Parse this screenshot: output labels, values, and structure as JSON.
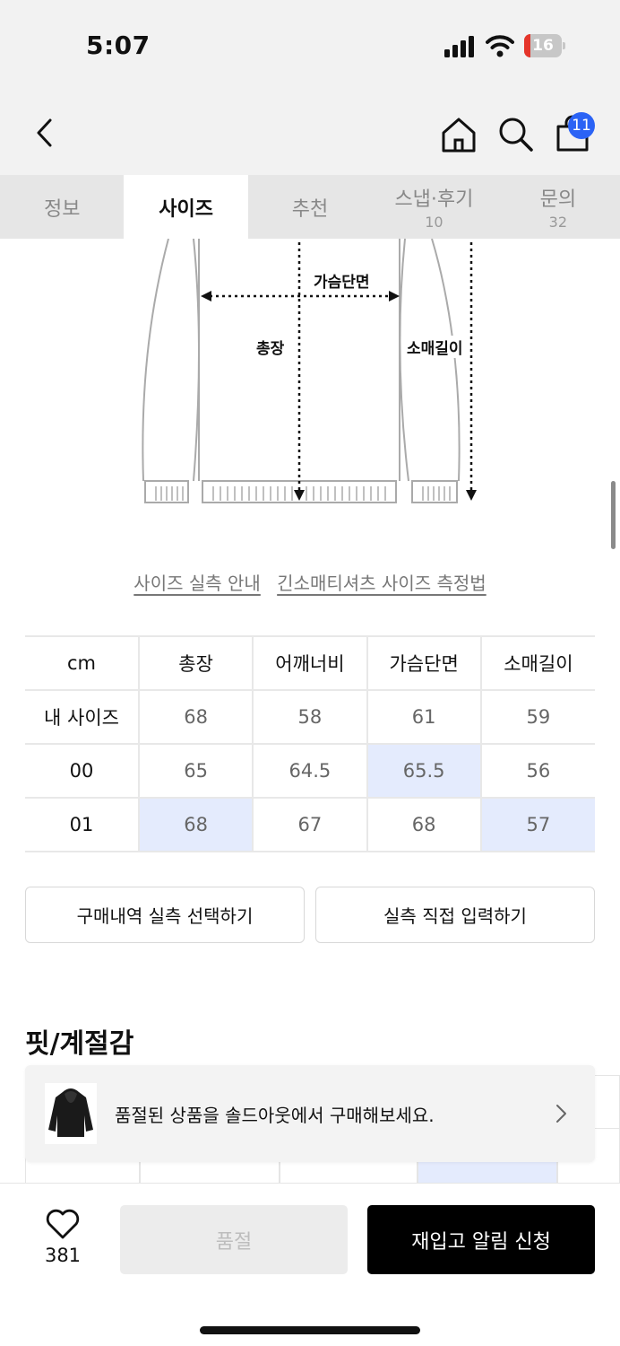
{
  "status_bar": {
    "time": "5:07",
    "battery_level": "16",
    "battery_fraction": 0.16,
    "battery_color": "#e5352b"
  },
  "header": {
    "back_icon": "chevron-left-icon",
    "home_icon": "home-icon",
    "search_icon": "search-icon",
    "bag_icon": "shopping-bag-icon",
    "cart_count": "11",
    "badge_color": "#2b63f5"
  },
  "tabs": [
    {
      "label": "정보",
      "count": ""
    },
    {
      "label": "사이즈",
      "count": "",
      "active": true
    },
    {
      "label": "추천",
      "count": ""
    },
    {
      "label": "스냅·후기",
      "count": "10"
    },
    {
      "label": "문의",
      "count": "32"
    }
  ],
  "diagram": {
    "chest_label": "가슴단면",
    "length_label": "총장",
    "sleeve_label": "소매길이"
  },
  "links": {
    "size_guide": "사이즈 실측 안내",
    "measure_guide": "긴소매티셔츠 사이즈 측정법"
  },
  "size_table": {
    "headers": [
      "cm",
      "총장",
      "어깨너비",
      "가슴단면",
      "소매길이"
    ],
    "rows": [
      {
        "label": "내 사이즈",
        "values": [
          "68",
          "58",
          "61",
          "59"
        ],
        "highlight": [
          false,
          false,
          false,
          false
        ]
      },
      {
        "label": "00",
        "values": [
          "65",
          "64.5",
          "65.5",
          "56"
        ],
        "highlight": [
          false,
          false,
          true,
          false
        ]
      },
      {
        "label": "01",
        "values": [
          "68",
          "67",
          "68",
          "57"
        ],
        "highlight": [
          true,
          false,
          false,
          true
        ]
      }
    ],
    "highlight_color": "#e4ebfd"
  },
  "buttons": {
    "select_history": "구매내역 실측 선택하기",
    "direct_input": "실측 직접 입력하기"
  },
  "fit_section": {
    "title": "핏/계절감"
  },
  "toast": {
    "text": "품절된 상품을 솔드아웃에서 구매해보세요.",
    "thumb_icon": "hoodie-thumbnail"
  },
  "bottom_bar": {
    "heart_icon": "heart-icon",
    "like_count": "381",
    "soldout_label": "품절",
    "restock_label": "재입고 알림 신청"
  }
}
